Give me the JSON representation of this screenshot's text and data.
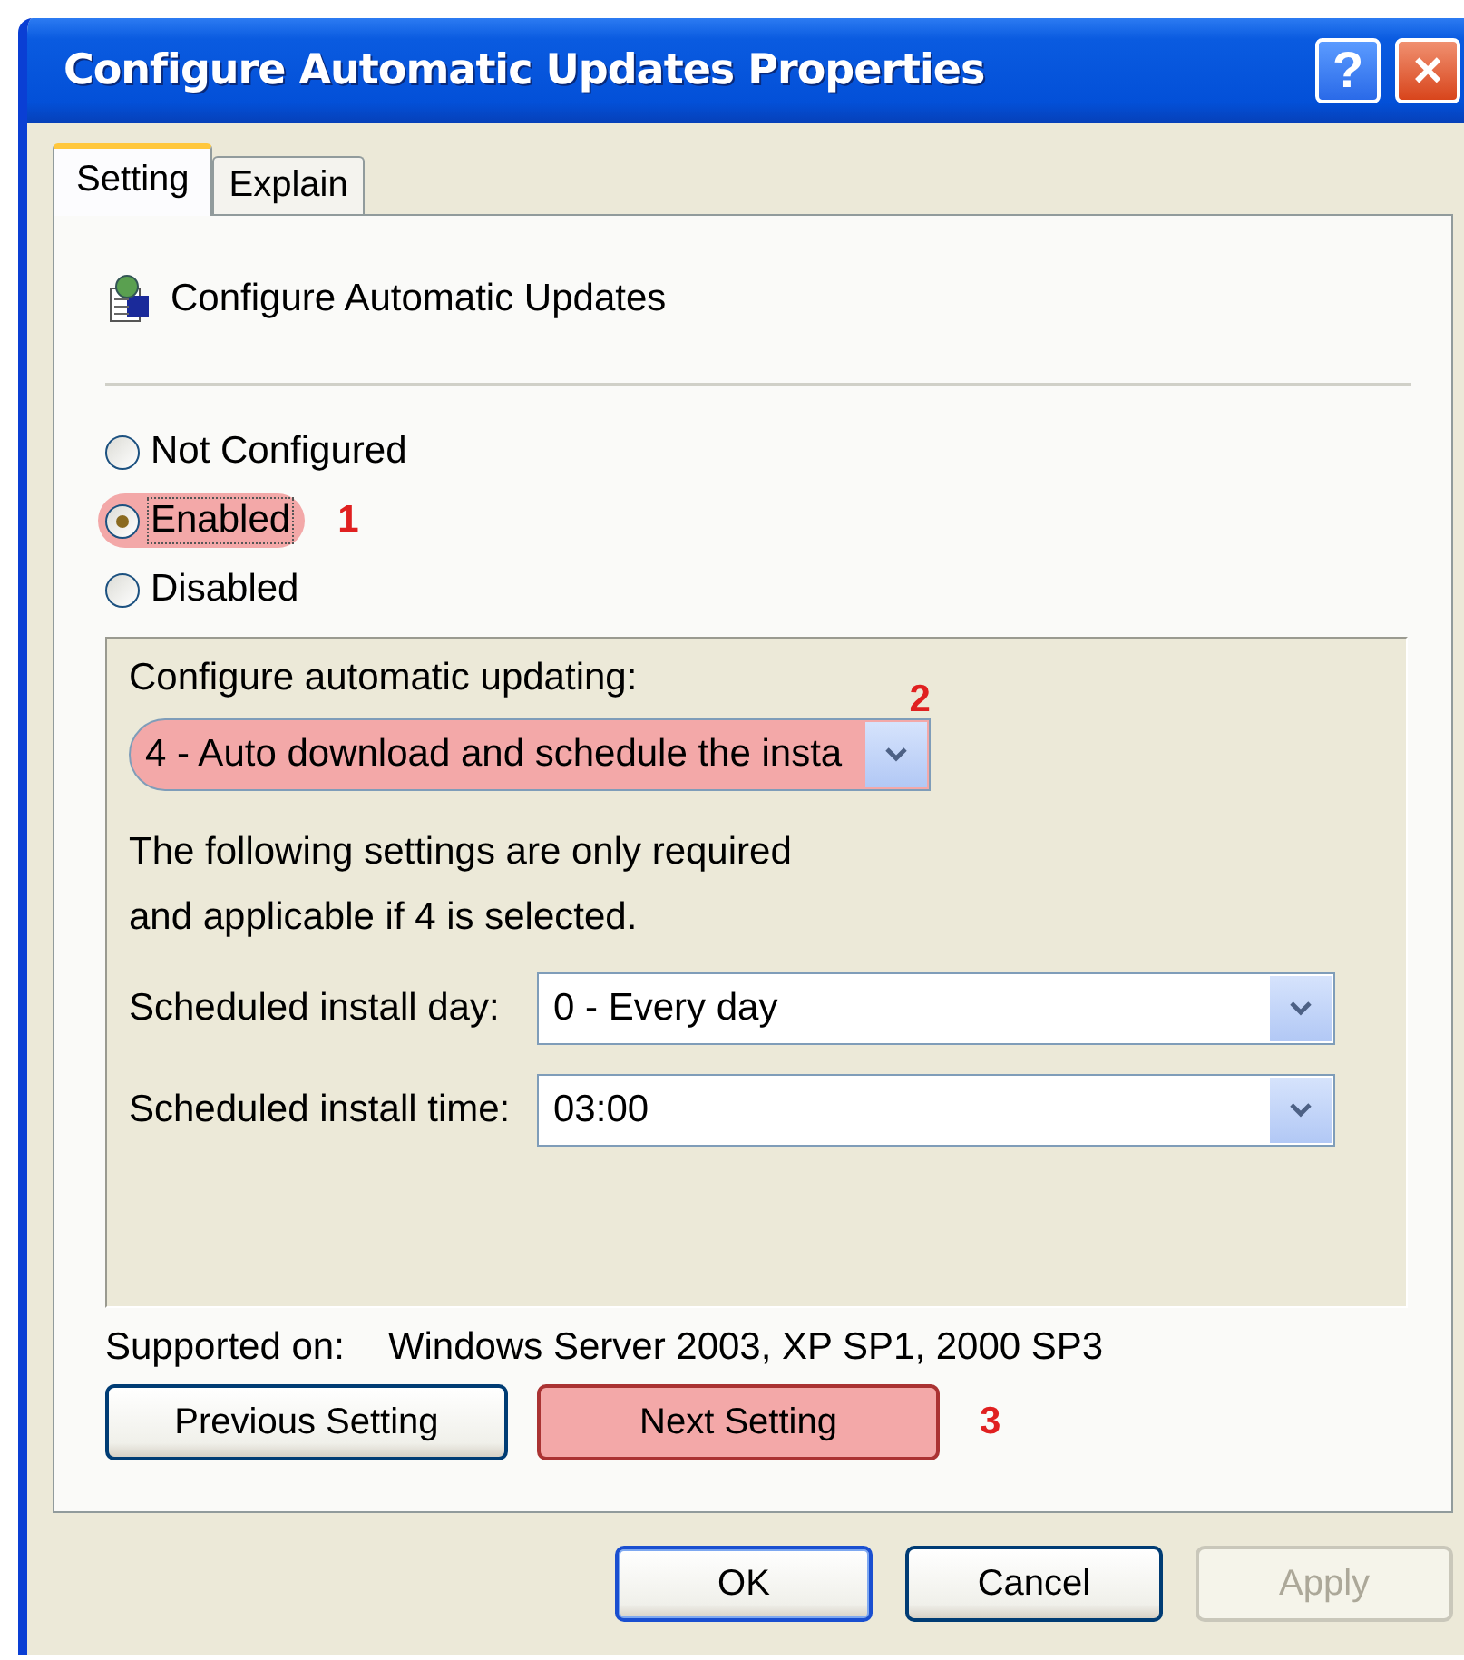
{
  "window": {
    "title": "Configure Automatic Updates Properties",
    "help_button": "?",
    "close_button": "×"
  },
  "tabs": [
    {
      "label": "Setting",
      "selected": true
    },
    {
      "label": "Explain",
      "selected": false
    }
  ],
  "policy": {
    "name": "Configure Automatic Updates"
  },
  "options": [
    {
      "label": "Not Configured",
      "selected": false,
      "focused": false,
      "highlighted": false
    },
    {
      "label": "Enabled",
      "selected": true,
      "focused": true,
      "highlighted": true,
      "annotation": "1"
    },
    {
      "label": "Disabled",
      "selected": false,
      "focused": false,
      "highlighted": false
    }
  ],
  "settings": {
    "update_label": "Configure automatic updating:",
    "update_value": "4 - Auto download and schedule the insta",
    "update_highlighted": true,
    "update_annotation": "2",
    "note_lines": [
      "The following settings are only required",
      "and applicable if 4 is selected."
    ],
    "fields": [
      {
        "label": "Scheduled install day:",
        "value": "0 - Every day"
      },
      {
        "label": "Scheduled install time:",
        "value": "03:00"
      }
    ]
  },
  "supported": {
    "label": "Supported on:",
    "value": "Windows Server 2003, XP SP1, 2000 SP3"
  },
  "nav_buttons": [
    {
      "label": "Previous Setting",
      "highlighted": false
    },
    {
      "label": "Next Setting",
      "highlighted": true,
      "annotation": "3"
    }
  ],
  "buttons": [
    {
      "label": "OK",
      "default": true,
      "disabled": false
    },
    {
      "label": "Cancel",
      "default": false,
      "disabled": false
    },
    {
      "label": "Apply",
      "default": false,
      "disabled": true
    }
  ]
}
